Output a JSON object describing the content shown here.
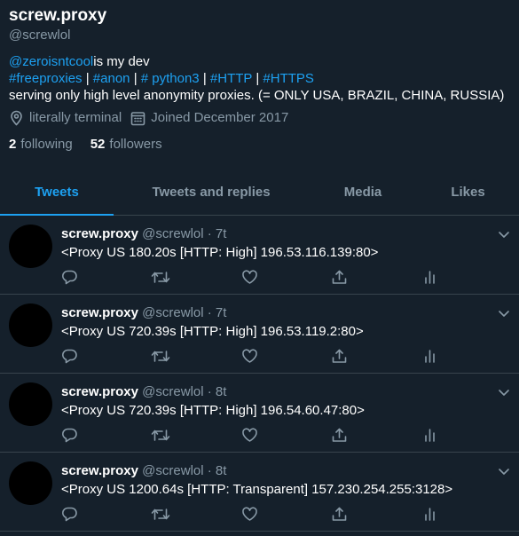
{
  "profile": {
    "display_name": "screw.proxy",
    "handle": "@screwlol",
    "bio": {
      "mention": "@zeroisntcool",
      "line1_rest": "is my dev",
      "tags": [
        "#freeproxies",
        "#anon",
        "# python3",
        "#HTTP",
        "#HTTPS"
      ],
      "separator": "|",
      "line3": "serving only high level anonymity proxies. (= ONLY USA, BRAZIL, CHINA, RUSSIA)"
    },
    "location": "literally terminal",
    "location_icon": "location-pin-icon",
    "joined": "Joined December 2017",
    "joined_icon": "calendar-icon",
    "following_count": "2",
    "following_label": "following",
    "followers_count": "52",
    "followers_label": "followers"
  },
  "tabs": [
    {
      "label": "Tweets",
      "active": true
    },
    {
      "label": "Tweets and replies",
      "active": false
    },
    {
      "label": "Media",
      "active": false
    },
    {
      "label": "Likes",
      "active": false
    }
  ],
  "tweets": [
    {
      "name": "screw.proxy",
      "handle": "@screwlol",
      "dot": "·",
      "time": "7t",
      "text": "<Proxy US 180.20s [HTTP: High] 196.53.116.139:80>"
    },
    {
      "name": "screw.proxy",
      "handle": "@screwlol",
      "dot": "·",
      "time": "7t",
      "text": "<Proxy US 720.39s [HTTP: High] 196.53.119.2:80>"
    },
    {
      "name": "screw.proxy",
      "handle": "@screwlol",
      "dot": "·",
      "time": "8t",
      "text": "<Proxy US 720.39s [HTTP: High] 196.54.60.47:80>"
    },
    {
      "name": "screw.proxy",
      "handle": "@screwlol",
      "dot": "·",
      "time": "8t",
      "text": "<Proxy US 1200.64s [HTTP: Transparent] 157.230.254.255:3128>"
    }
  ],
  "colors": {
    "background": "#15202b",
    "accent": "#1da1f2",
    "muted": "#8899a6",
    "divider": "#38444d",
    "avatar": "#000000"
  }
}
